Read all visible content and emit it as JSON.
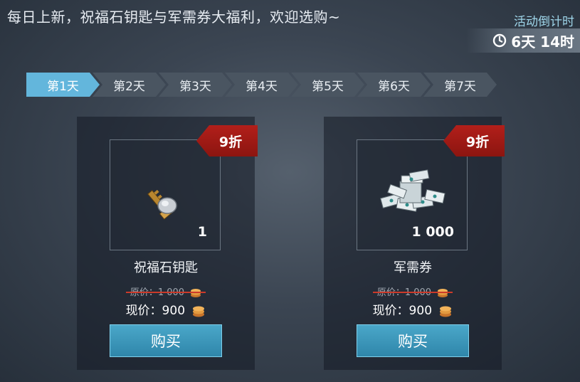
{
  "header": {
    "headline": "每日上新，祝福石钥匙与军需券大福利，欢迎选购~",
    "timer_label": "活动倒计时",
    "timer_value": "6天 14时",
    "timer_icon": "clock-icon"
  },
  "days": [
    {
      "label": "第1天",
      "active": true
    },
    {
      "label": "第2天",
      "active": false
    },
    {
      "label": "第3天",
      "active": false
    },
    {
      "label": "第4天",
      "active": false
    },
    {
      "label": "第5天",
      "active": false
    },
    {
      "label": "第6天",
      "active": false
    },
    {
      "label": "第7天",
      "active": false
    }
  ],
  "items": [
    {
      "discount": "9折",
      "quantity": "1",
      "name": "祝福石钥匙",
      "original_price_label": "原价：1 000",
      "current_price_label": "现价：900",
      "buy_label": "购买",
      "icon": "blessing-stone-key-icon"
    },
    {
      "discount": "9折",
      "quantity": "1 000",
      "name": "军需券",
      "original_price_label": "原价：1 000",
      "current_price_label": "现价：900",
      "buy_label": "购买",
      "icon": "supply-voucher-stack-icon"
    }
  ],
  "colors": {
    "active_tab": "#63b6dc",
    "badge": "#b21f1a",
    "buy_button": "#2f86aa",
    "strike": "#cc3a2a"
  }
}
